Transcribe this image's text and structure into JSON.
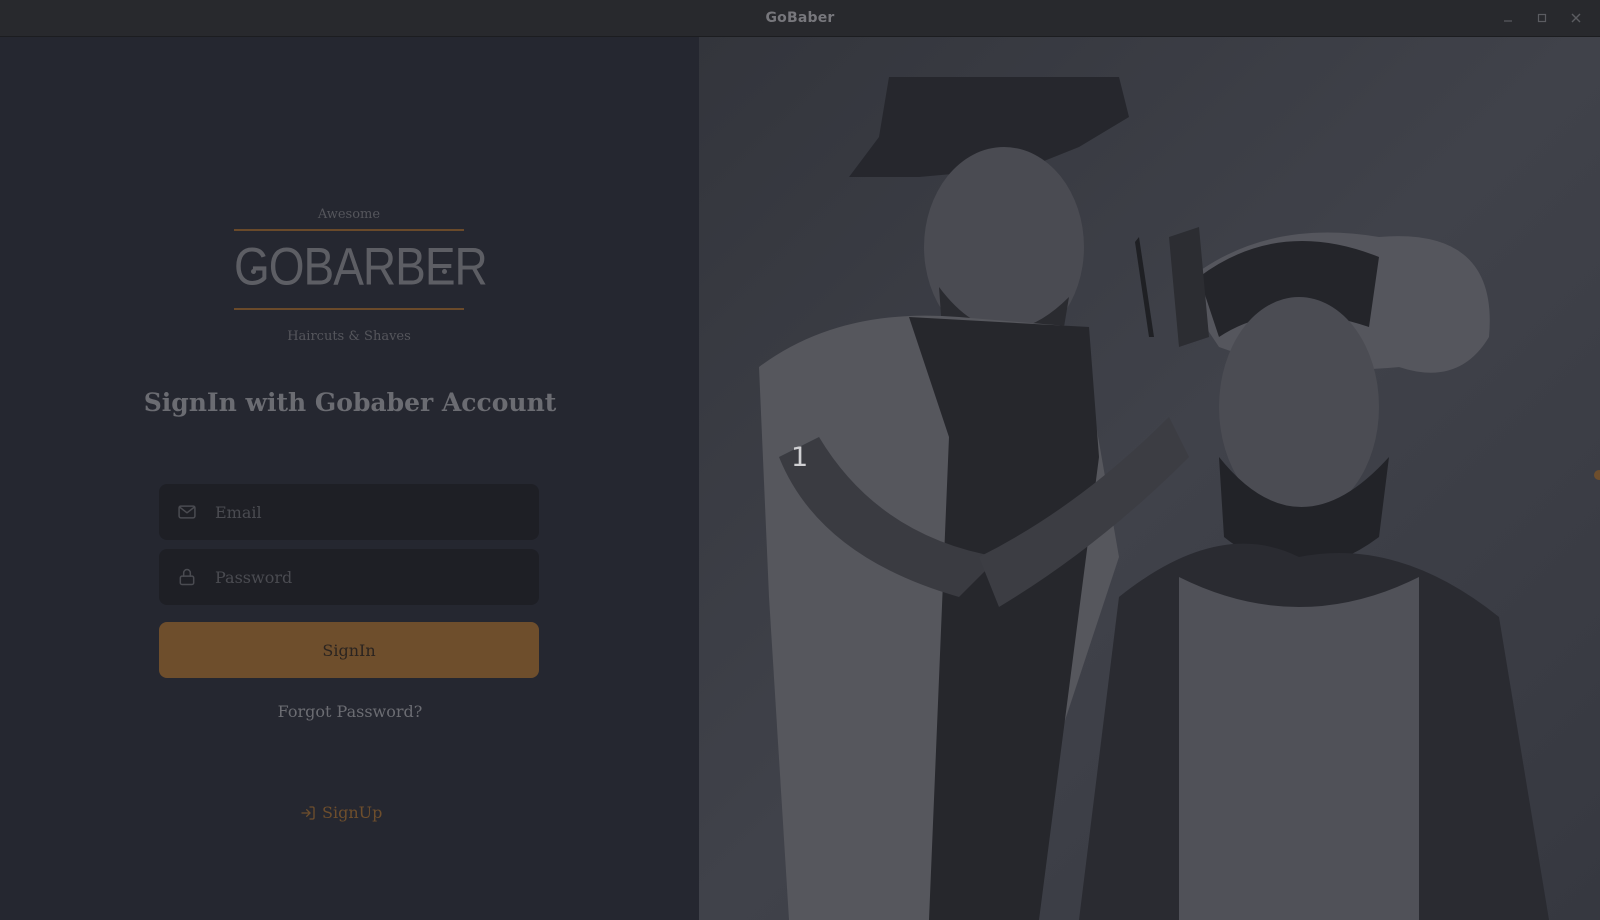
{
  "window": {
    "title": "GoBaber",
    "controls": [
      "minimize-icon",
      "maximize-icon",
      "close-icon"
    ]
  },
  "logo": {
    "tag_top": "Awesome",
    "brand": "GOBARBER",
    "tag_bottom": "Haircuts & Shaves"
  },
  "form": {
    "title": "SignIn with Gobaber Account",
    "email": {
      "placeholder": "Email",
      "value": "",
      "icon": "mail-icon"
    },
    "password": {
      "placeholder": "Password",
      "value": "",
      "icon": "lock-icon"
    },
    "submit_label": "SignIn",
    "forgot_label": "Forgot Password?"
  },
  "signup": {
    "label": "SignUp",
    "icon": "log-in-icon"
  },
  "photo_overlay": {
    "label": "1"
  },
  "colors": {
    "accent": "#ff9000",
    "accent_dimmed": "#6e4e2c",
    "background": "#252730",
    "input_bg": "#1e1f25"
  }
}
